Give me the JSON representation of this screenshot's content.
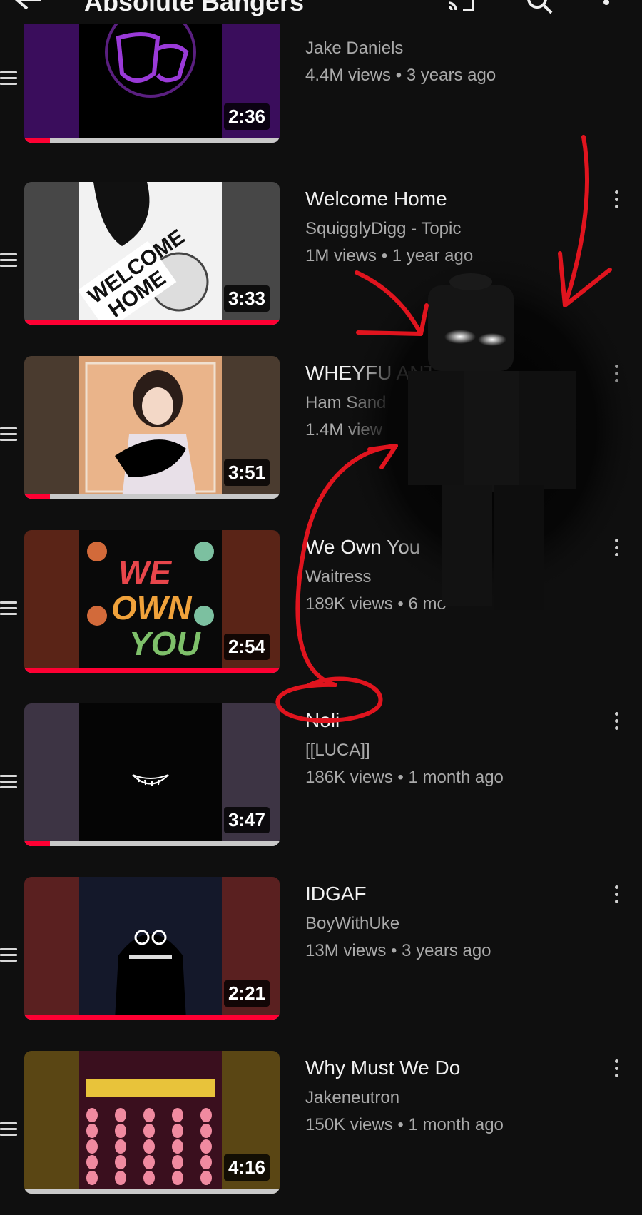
{
  "header": {
    "title": "Absolute Bangers",
    "back_icon": "arrow-left-icon",
    "cast_icon": "cast-icon",
    "search_icon": "search-icon",
    "more_icon": "more-vert-icon"
  },
  "videos": [
    {
      "title": "",
      "channel": "Jake Daniels",
      "meta": "4.4M views • 3 years ago",
      "duration": "2:36",
      "progress": 0.1,
      "bg": "#3a0d5c",
      "art": "mask"
    },
    {
      "title": "Welcome Home",
      "channel": "SquigglyDigg - Topic",
      "meta": "1M views • 1 year ago",
      "duration": "3:33",
      "progress": 1.0,
      "bg": "#474747",
      "art": "welcome"
    },
    {
      "title": "WHEYFU ANT",
      "channel": "Ham Sand",
      "meta": "1.4M view",
      "duration": "3:51",
      "progress": 0.1,
      "bg": "#4a3b2f",
      "art": "girl"
    },
    {
      "title": "We Own You",
      "channel": "Waitress",
      "meta": "189K views • 6 mo",
      "duration": "2:54",
      "progress": 1.0,
      "bg": "#5a2417",
      "art": "weown"
    },
    {
      "title": "Noli",
      "channel": "[[LUCA]]",
      "meta": "186K views • 1 month ago",
      "duration": "3:47",
      "progress": 0.1,
      "bg": "#3d3444",
      "art": "smile"
    },
    {
      "title": "IDGAF",
      "channel": "BoyWithUke",
      "meta": "13M views • 3 years ago",
      "duration": "2:21",
      "progress": 1.0,
      "bg": "#5a2020",
      "art": "ghost"
    },
    {
      "title": "Why Must We Do",
      "channel": "Jakeneutron",
      "meta": "150K views • 1 month ago",
      "duration": "4:16",
      "progress": 0.0,
      "bg": "#5a4614",
      "art": "pattern"
    }
  ],
  "colors": {
    "background": "#0f0f0f",
    "progress": "#ff0033",
    "annotation": "#e0141e"
  },
  "annotation": {
    "circled_item": "Noli",
    "figure": "dark-roblox-figure-with-glowing-eyes"
  }
}
